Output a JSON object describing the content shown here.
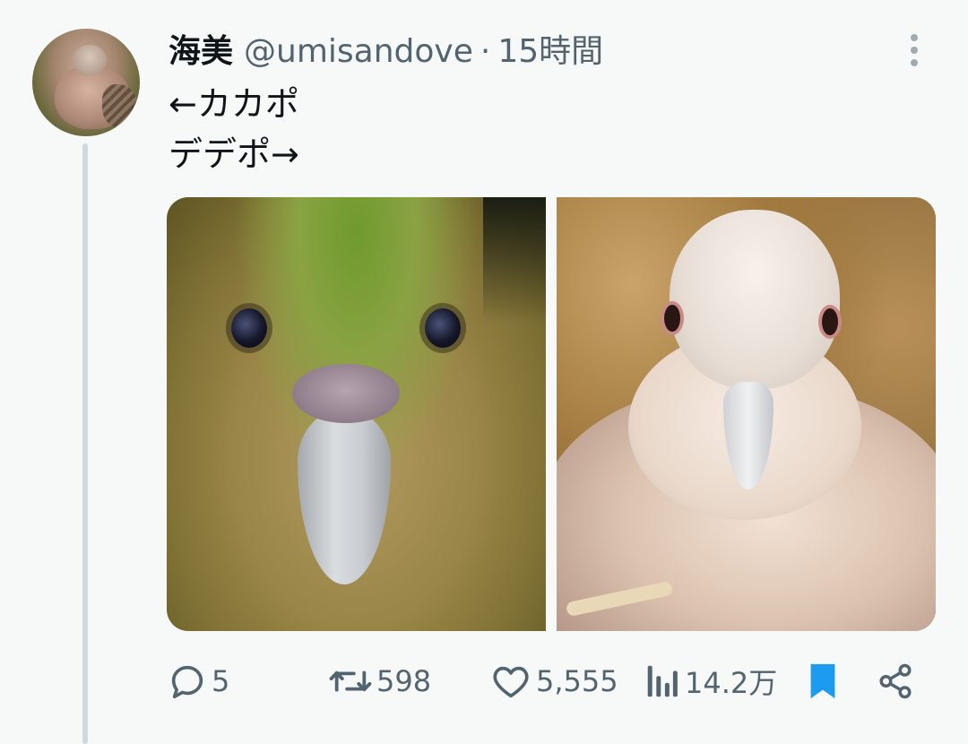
{
  "tweet": {
    "author_name": "海美",
    "handle": "@umisandove",
    "separator": "·",
    "time": "15時間",
    "text_lines": [
      "←カカポ",
      "デデポ→"
    ]
  },
  "media": [
    {
      "subject": "kakapo"
    },
    {
      "subject": "dove"
    }
  ],
  "actions": {
    "reply_count": "5",
    "retweet_count": "598",
    "like_count": "5,555",
    "views_count": "14.2万",
    "bookmarked": true
  },
  "colors": {
    "bookmark_active": "#1d9bf0",
    "muted": "#536471",
    "thread_line": "#cfd9de"
  },
  "icons": [
    "more-icon",
    "reply-icon",
    "retweet-icon",
    "like-icon",
    "views-icon",
    "bookmark-icon",
    "share-icon"
  ]
}
